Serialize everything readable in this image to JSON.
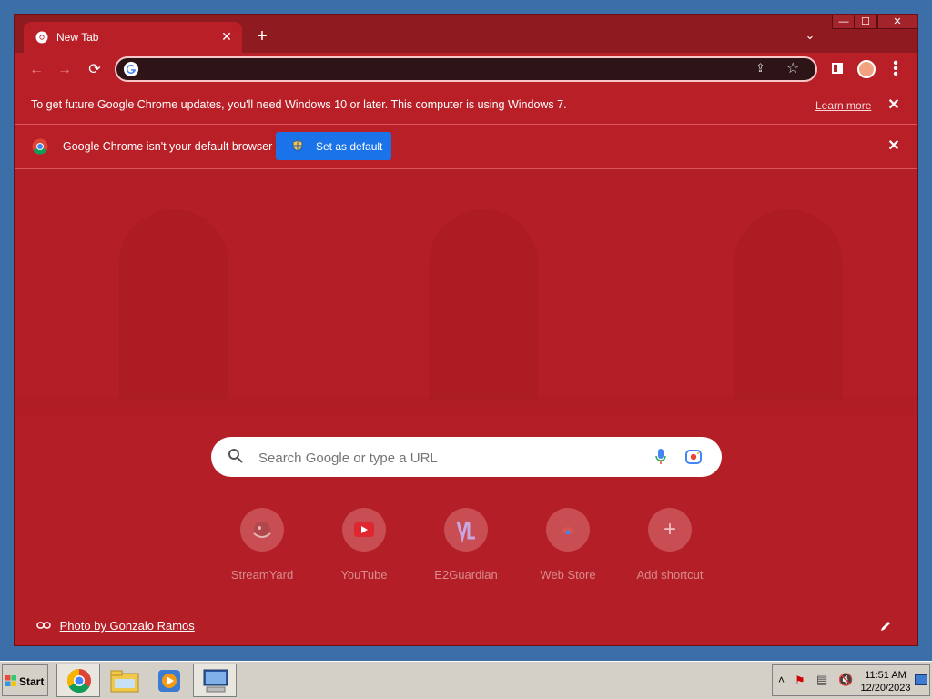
{
  "browser": {
    "tab": {
      "title": "New Tab",
      "close": "✕"
    },
    "new_tab": "+",
    "tab_search": "⌄",
    "window_controls": {
      "minimize": "—",
      "maximize": "☐",
      "close": "✕"
    },
    "toolbar": {
      "back": "←",
      "forward": "→",
      "reload": "⟳",
      "omnibox_value": "",
      "menu": "⋮"
    }
  },
  "infobar_update": {
    "message": "To get future Google Chrome updates, you'll need Windows 10 or later. This computer is using Windows 7.",
    "learn_more": "Learn more",
    "close": "✕"
  },
  "infobar_default": {
    "message": "Google Chrome isn't your default browser",
    "button": "Set as default",
    "close": "✕"
  },
  "ntp": {
    "search_placeholder": "Search Google or type a URL",
    "shortcuts": [
      {
        "label": "StreamYard"
      },
      {
        "label": "YouTube"
      },
      {
        "label": "E2Guardian"
      },
      {
        "label": "Web Store"
      },
      {
        "label": "Add shortcut",
        "glyph": "+"
      }
    ],
    "photo_credit": "Photo by Gonzalo Ramos"
  },
  "taskbar": {
    "start": "Start",
    "time": "11:51 AM",
    "date": "12/20/2023"
  },
  "colors": {
    "frame": "#8f1a1f",
    "theme": "#b81f27",
    "button_blue": "#1a73e8"
  }
}
